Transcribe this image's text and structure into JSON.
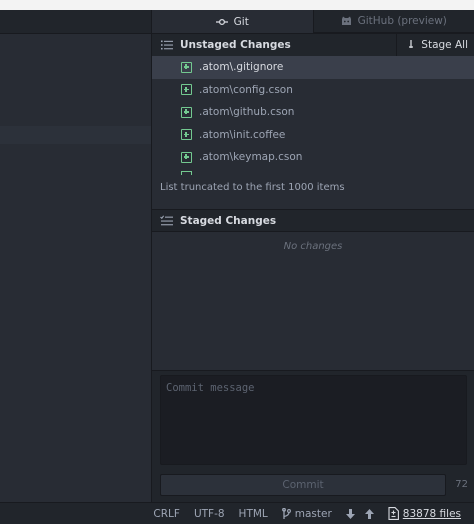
{
  "tabs": {
    "git": {
      "label": "Git",
      "icon": "git-commit-icon"
    },
    "github": {
      "label": "GitHub (preview)",
      "icon": "octocat-icon"
    }
  },
  "unstaged": {
    "title": "Unstaged Changes",
    "stage_all_label": "Stage All",
    "files": [
      {
        "name": ".atom\\.gitignore",
        "status": "added",
        "selected": true
      },
      {
        "name": ".atom\\config.cson",
        "status": "added"
      },
      {
        "name": ".atom\\github.cson",
        "status": "added"
      },
      {
        "name": ".atom\\init.coffee",
        "status": "added"
      },
      {
        "name": ".atom\\keymap.cson",
        "status": "added"
      }
    ],
    "truncated_note": "List truncated to the first 1000 items"
  },
  "staged": {
    "title": "Staged Changes",
    "empty_text": "No changes"
  },
  "commit": {
    "placeholder": "Commit message",
    "button_label": "Commit",
    "remaining_chars": "72"
  },
  "status_bar": {
    "line_ending": "CRLF",
    "encoding": "UTF-8",
    "grammar": "HTML",
    "branch": "master",
    "file_count": "83878 files"
  },
  "colors": {
    "accent_added": "#73c990",
    "panel_bg": "#21252b",
    "editor_bg": "#282c34",
    "selected_bg": "#3a3f4b"
  }
}
